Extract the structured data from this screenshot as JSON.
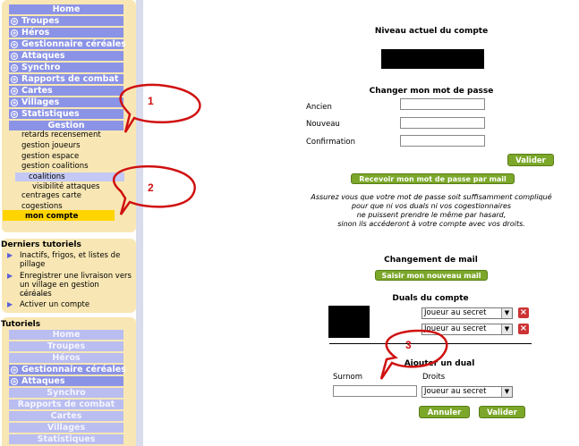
{
  "nav": {
    "items": [
      {
        "label": "Home",
        "plus": false
      },
      {
        "label": "Troupes",
        "plus": true
      },
      {
        "label": "Héros",
        "plus": true
      },
      {
        "label": "Gestionnaire céréales",
        "plus": true
      },
      {
        "label": "Attaques",
        "plus": true
      },
      {
        "label": "Synchro",
        "plus": true
      },
      {
        "label": "Rapports de combat",
        "plus": true
      },
      {
        "label": "Cartes",
        "plus": true
      },
      {
        "label": "Villages",
        "plus": true
      },
      {
        "label": "Statistiques",
        "plus": true
      },
      {
        "label": "Gestion",
        "plus": false
      }
    ],
    "gestion_sub": [
      "retards recensement",
      "gestion joueurs",
      "gestion espace",
      "gestion coalitions",
      "coalitions",
      "visibilité attaques",
      "centrages carte",
      "cogestions",
      "mon compte"
    ]
  },
  "derniers": {
    "title": "Derniers tutoriels",
    "items": [
      "Inactifs, frigos, et listes de pillage",
      "Enregistrer une livraison vers un village en gestion céréales",
      "Activer un compte"
    ],
    "divider": "----------"
  },
  "tutoriels": {
    "title": "Tutoriels",
    "items": [
      {
        "label": "Home",
        "plus": false,
        "style": "light"
      },
      {
        "label": "Troupes",
        "plus": false,
        "style": "light"
      },
      {
        "label": "Héros",
        "plus": false,
        "style": "light"
      },
      {
        "label": "Gestionnaire céréales",
        "plus": true,
        "style": "dark"
      },
      {
        "label": "Attaques",
        "plus": true,
        "style": "dark"
      },
      {
        "label": "Synchro",
        "plus": false,
        "style": "light"
      },
      {
        "label": "Rapports de combat",
        "plus": false,
        "style": "light"
      },
      {
        "label": "Cartes",
        "plus": false,
        "style": "light"
      },
      {
        "label": "Villages",
        "plus": false,
        "style": "light"
      },
      {
        "label": "Statistiques",
        "plus": false,
        "style": "light"
      }
    ]
  },
  "level": {
    "title": "Niveau actuel du compte"
  },
  "password": {
    "title": "Changer mon mot de passe",
    "old_label": "Ancien",
    "new_label": "Nouveau",
    "confirm_label": "Confirmation",
    "validate": "Valider",
    "by_mail": "Recevoir mon mot de passe par mail",
    "notice": [
      "Assurez vous que votre mot de passe soit suffisamment compliqué",
      "pour que ni vos duals ni vos cogestionnaires",
      "ne puissent prendre le même par hasard,",
      "sinon ils accéderont à votre compte avec vos droits."
    ]
  },
  "mail": {
    "title": "Changement de mail",
    "button": "Saisir mon nouveau mail"
  },
  "duals": {
    "title": "Duals du compte",
    "rows": [
      {
        "role": "Joueur au secret"
      },
      {
        "role": "Joueur au secret"
      }
    ],
    "add_title": "Ajouter un dual",
    "surname_label": "Surnom",
    "rights_label": "Droits",
    "rights_value": "Joueur au secret",
    "cancel": "Annuler",
    "validate": "Valider"
  },
  "annotations": [
    "1",
    "2",
    "3"
  ],
  "colors": {
    "nav": "#8b93e6",
    "panel": "#f8e7b4",
    "accent": "#ffd400",
    "green": "#7ba72a",
    "annotation": "#d01010"
  }
}
